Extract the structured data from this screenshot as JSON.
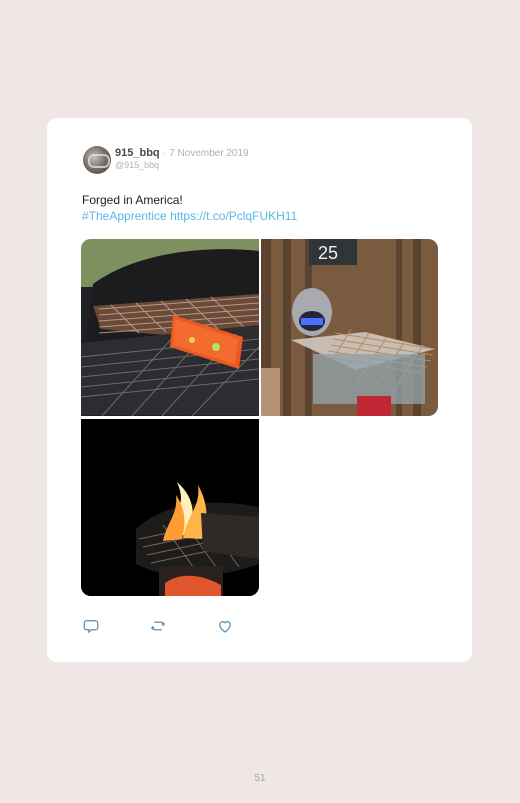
{
  "post": {
    "display_name": "915_bbq",
    "separator": "·",
    "date": "7 November 2019",
    "username": "@915_bbq",
    "text_line_1": "Forged in America!",
    "hashtag": "#TheApprentice",
    "link": "https://t.co/PclqFUKH11",
    "images": [
      {
        "name": "grill-grate-photo",
        "icon": "grill-photo"
      },
      {
        "name": "workshop-welding-photo",
        "icon": "workshop-photo"
      },
      {
        "name": "fire-grill-photo",
        "icon": "fire-photo"
      }
    ],
    "actions": [
      {
        "name": "reply-button",
        "icon": "reply-icon"
      },
      {
        "name": "retweet-button",
        "icon": "retweet-icon"
      },
      {
        "name": "like-button",
        "icon": "heart-icon"
      }
    ]
  },
  "footer": {
    "page_number": "51"
  },
  "colors": {
    "background": "#efe6e6",
    "card": "#ffffff",
    "link": "#58b6e8",
    "muted": "#b0b0b0"
  }
}
